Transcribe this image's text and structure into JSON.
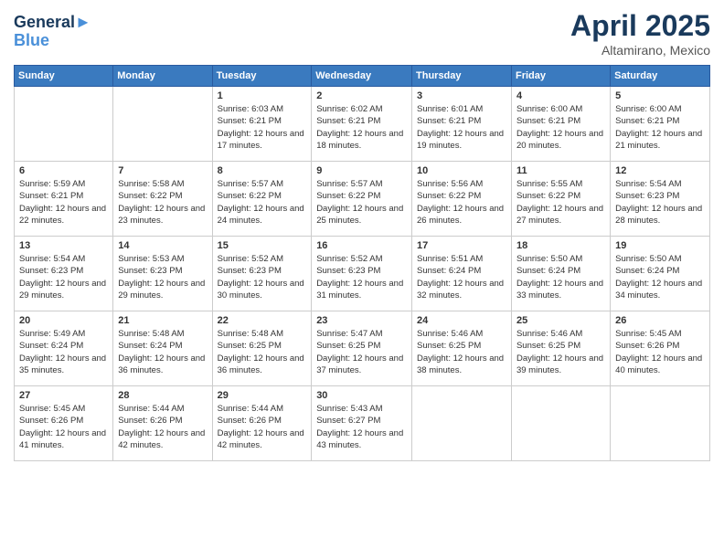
{
  "header": {
    "logo_line1": "General",
    "logo_line2": "Blue",
    "month": "April 2025",
    "location": "Altamirano, Mexico"
  },
  "weekdays": [
    "Sunday",
    "Monday",
    "Tuesday",
    "Wednesday",
    "Thursday",
    "Friday",
    "Saturday"
  ],
  "weeks": [
    [
      {
        "day": "",
        "sunrise": "",
        "sunset": "",
        "daylight": ""
      },
      {
        "day": "",
        "sunrise": "",
        "sunset": "",
        "daylight": ""
      },
      {
        "day": "1",
        "sunrise": "Sunrise: 6:03 AM",
        "sunset": "Sunset: 6:21 PM",
        "daylight": "Daylight: 12 hours and 17 minutes."
      },
      {
        "day": "2",
        "sunrise": "Sunrise: 6:02 AM",
        "sunset": "Sunset: 6:21 PM",
        "daylight": "Daylight: 12 hours and 18 minutes."
      },
      {
        "day": "3",
        "sunrise": "Sunrise: 6:01 AM",
        "sunset": "Sunset: 6:21 PM",
        "daylight": "Daylight: 12 hours and 19 minutes."
      },
      {
        "day": "4",
        "sunrise": "Sunrise: 6:00 AM",
        "sunset": "Sunset: 6:21 PM",
        "daylight": "Daylight: 12 hours and 20 minutes."
      },
      {
        "day": "5",
        "sunrise": "Sunrise: 6:00 AM",
        "sunset": "Sunset: 6:21 PM",
        "daylight": "Daylight: 12 hours and 21 minutes."
      }
    ],
    [
      {
        "day": "6",
        "sunrise": "Sunrise: 5:59 AM",
        "sunset": "Sunset: 6:21 PM",
        "daylight": "Daylight: 12 hours and 22 minutes."
      },
      {
        "day": "7",
        "sunrise": "Sunrise: 5:58 AM",
        "sunset": "Sunset: 6:22 PM",
        "daylight": "Daylight: 12 hours and 23 minutes."
      },
      {
        "day": "8",
        "sunrise": "Sunrise: 5:57 AM",
        "sunset": "Sunset: 6:22 PM",
        "daylight": "Daylight: 12 hours and 24 minutes."
      },
      {
        "day": "9",
        "sunrise": "Sunrise: 5:57 AM",
        "sunset": "Sunset: 6:22 PM",
        "daylight": "Daylight: 12 hours and 25 minutes."
      },
      {
        "day": "10",
        "sunrise": "Sunrise: 5:56 AM",
        "sunset": "Sunset: 6:22 PM",
        "daylight": "Daylight: 12 hours and 26 minutes."
      },
      {
        "day": "11",
        "sunrise": "Sunrise: 5:55 AM",
        "sunset": "Sunset: 6:22 PM",
        "daylight": "Daylight: 12 hours and 27 minutes."
      },
      {
        "day": "12",
        "sunrise": "Sunrise: 5:54 AM",
        "sunset": "Sunset: 6:23 PM",
        "daylight": "Daylight: 12 hours and 28 minutes."
      }
    ],
    [
      {
        "day": "13",
        "sunrise": "Sunrise: 5:54 AM",
        "sunset": "Sunset: 6:23 PM",
        "daylight": "Daylight: 12 hours and 29 minutes."
      },
      {
        "day": "14",
        "sunrise": "Sunrise: 5:53 AM",
        "sunset": "Sunset: 6:23 PM",
        "daylight": "Daylight: 12 hours and 29 minutes."
      },
      {
        "day": "15",
        "sunrise": "Sunrise: 5:52 AM",
        "sunset": "Sunset: 6:23 PM",
        "daylight": "Daylight: 12 hours and 30 minutes."
      },
      {
        "day": "16",
        "sunrise": "Sunrise: 5:52 AM",
        "sunset": "Sunset: 6:23 PM",
        "daylight": "Daylight: 12 hours and 31 minutes."
      },
      {
        "day": "17",
        "sunrise": "Sunrise: 5:51 AM",
        "sunset": "Sunset: 6:24 PM",
        "daylight": "Daylight: 12 hours and 32 minutes."
      },
      {
        "day": "18",
        "sunrise": "Sunrise: 5:50 AM",
        "sunset": "Sunset: 6:24 PM",
        "daylight": "Daylight: 12 hours and 33 minutes."
      },
      {
        "day": "19",
        "sunrise": "Sunrise: 5:50 AM",
        "sunset": "Sunset: 6:24 PM",
        "daylight": "Daylight: 12 hours and 34 minutes."
      }
    ],
    [
      {
        "day": "20",
        "sunrise": "Sunrise: 5:49 AM",
        "sunset": "Sunset: 6:24 PM",
        "daylight": "Daylight: 12 hours and 35 minutes."
      },
      {
        "day": "21",
        "sunrise": "Sunrise: 5:48 AM",
        "sunset": "Sunset: 6:24 PM",
        "daylight": "Daylight: 12 hours and 36 minutes."
      },
      {
        "day": "22",
        "sunrise": "Sunrise: 5:48 AM",
        "sunset": "Sunset: 6:25 PM",
        "daylight": "Daylight: 12 hours and 36 minutes."
      },
      {
        "day": "23",
        "sunrise": "Sunrise: 5:47 AM",
        "sunset": "Sunset: 6:25 PM",
        "daylight": "Daylight: 12 hours and 37 minutes."
      },
      {
        "day": "24",
        "sunrise": "Sunrise: 5:46 AM",
        "sunset": "Sunset: 6:25 PM",
        "daylight": "Daylight: 12 hours and 38 minutes."
      },
      {
        "day": "25",
        "sunrise": "Sunrise: 5:46 AM",
        "sunset": "Sunset: 6:25 PM",
        "daylight": "Daylight: 12 hours and 39 minutes."
      },
      {
        "day": "26",
        "sunrise": "Sunrise: 5:45 AM",
        "sunset": "Sunset: 6:26 PM",
        "daylight": "Daylight: 12 hours and 40 minutes."
      }
    ],
    [
      {
        "day": "27",
        "sunrise": "Sunrise: 5:45 AM",
        "sunset": "Sunset: 6:26 PM",
        "daylight": "Daylight: 12 hours and 41 minutes."
      },
      {
        "day": "28",
        "sunrise": "Sunrise: 5:44 AM",
        "sunset": "Sunset: 6:26 PM",
        "daylight": "Daylight: 12 hours and 42 minutes."
      },
      {
        "day": "29",
        "sunrise": "Sunrise: 5:44 AM",
        "sunset": "Sunset: 6:26 PM",
        "daylight": "Daylight: 12 hours and 42 minutes."
      },
      {
        "day": "30",
        "sunrise": "Sunrise: 5:43 AM",
        "sunset": "Sunset: 6:27 PM",
        "daylight": "Daylight: 12 hours and 43 minutes."
      },
      {
        "day": "",
        "sunrise": "",
        "sunset": "",
        "daylight": ""
      },
      {
        "day": "",
        "sunrise": "",
        "sunset": "",
        "daylight": ""
      },
      {
        "day": "",
        "sunrise": "",
        "sunset": "",
        "daylight": ""
      }
    ]
  ]
}
